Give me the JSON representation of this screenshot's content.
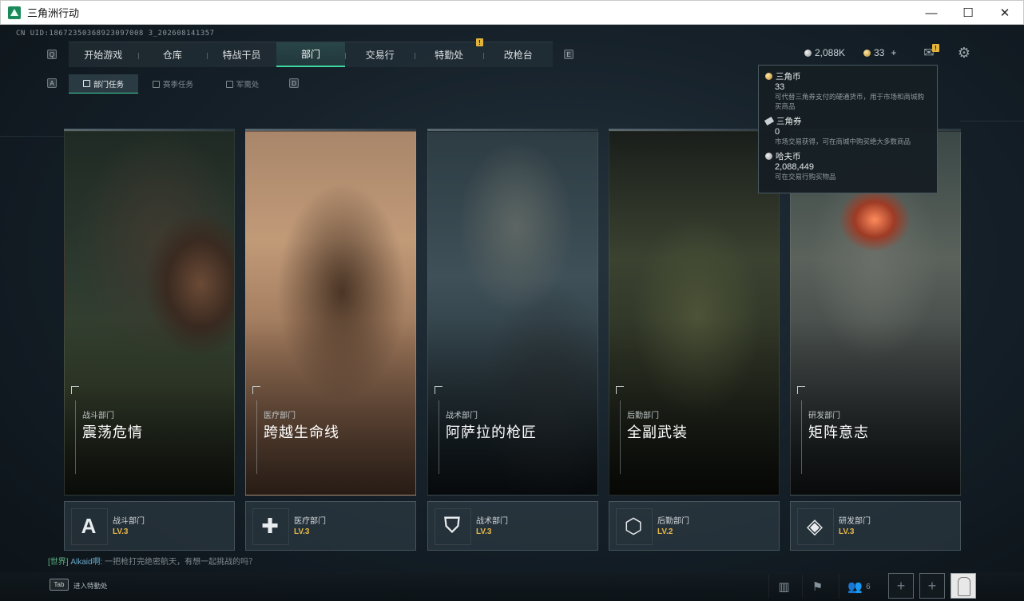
{
  "window": {
    "title": "三角洲行动",
    "minimize": "—",
    "maximize": "☐",
    "close": "✕"
  },
  "uid": "CN UID:18672350368923097008 3_202608141357",
  "nav": {
    "left_key": "Q",
    "right_key": "E",
    "items": [
      {
        "label": "开始游戏"
      },
      {
        "label": "仓库"
      },
      {
        "label": "特战干员"
      },
      {
        "label": "部门"
      },
      {
        "label": "交易行"
      },
      {
        "label": "特勤处"
      },
      {
        "label": "改枪台"
      }
    ],
    "alert": "!"
  },
  "subnav": {
    "left_key": "A",
    "right_key": "D",
    "items": [
      {
        "label": "部门任务"
      },
      {
        "label": "赛季任务"
      },
      {
        "label": "军需处"
      }
    ]
  },
  "currency": {
    "hafu": "2,088K",
    "triangle_coin": "33",
    "plus": "+",
    "mail_alert": "!"
  },
  "tooltip": {
    "items": [
      {
        "name": "三角币",
        "value": "33",
        "desc": "可代替三角券支付的硬通货币，用于市场和商城购买商品"
      },
      {
        "name": "三角券",
        "value": "0",
        "desc": "市场交易获得，可在商城中购买绝大多数商品"
      },
      {
        "name": "哈夫币",
        "value": "2,088,449",
        "desc": "可在交易行购买物品"
      }
    ]
  },
  "cards": [
    {
      "dept": "战斗部门",
      "title": "震荡危情",
      "badge_name": "战斗部门",
      "level": "LV.3",
      "icon": "combat-icon"
    },
    {
      "dept": "医疗部门",
      "title": "跨越生命线",
      "badge_name": "医疗部门",
      "level": "LV.3",
      "icon": "medical-cross-icon"
    },
    {
      "dept": "战术部门",
      "title": "阿萨拉的枪匠",
      "badge_name": "战术部门",
      "level": "LV.3",
      "icon": "tactical-shield-icon"
    },
    {
      "dept": "后勤部门",
      "title": "全副武装",
      "badge_name": "后勤部门",
      "level": "LV.2",
      "icon": "logistics-icon"
    },
    {
      "dept": "研发部门",
      "title": "矩阵意志",
      "badge_name": "研发部门",
      "level": "LV.3",
      "icon": "research-icon"
    }
  ],
  "chat": {
    "channel": "[世界]",
    "user": "Alkaid啊:",
    "message": "一把枪打完绝密航天，有想一起挑战的吗？"
  },
  "bottom": {
    "tab_key": "Tab",
    "tab_hint": "进入特勤处",
    "friends_count": "6",
    "plus": "+"
  },
  "colors": {
    "accent": "#3fd6a0",
    "level": "#e8b84a",
    "alert": "#e3b43a"
  }
}
